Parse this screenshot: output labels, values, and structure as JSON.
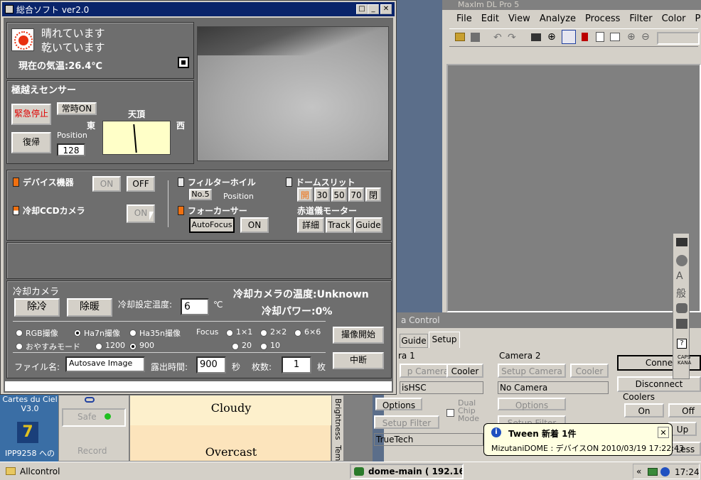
{
  "main_window": {
    "title": "総合ソフト ver2.0",
    "weather": {
      "line1": "晴れています",
      "line2": "乾いています",
      "temp": "現在の気温:26.4℃"
    },
    "meridian": {
      "title": "極越えセンサー",
      "emergency_stop": "緊急停止",
      "always_on": "常時ON",
      "reset": "復帰",
      "position_label": "Position",
      "position_value": "128",
      "east": "東",
      "zenith": "天頂",
      "west": "西"
    },
    "devices": {
      "device_label": "デバイス機器",
      "on": "ON",
      "off": "OFF",
      "ccd_label": "冷却CCDカメラ",
      "ccd_on": "ON",
      "filter_wheel": "フィルターホイル",
      "filter_no": "No.5",
      "filter_position": "Position",
      "focuser": "フォーカーサー",
      "autofocus": "AutoFocus",
      "focuser_on": "ON",
      "dome_slit": "ドームスリット",
      "slit_buttons": [
        "開",
        "30",
        "50",
        "70",
        "閉"
      ],
      "equatorial": "赤道儀モーター",
      "eq_buttons": [
        "詳細",
        "Track",
        "Guide"
      ]
    },
    "camera": {
      "title": "冷却カメラ",
      "cool": "除冷",
      "warm": "除暖",
      "set_temp_label": "冷却設定温度:",
      "set_temp_value": "6",
      "set_temp_unit": "℃",
      "temp_status": "冷却カメラの温度:Unknown",
      "power_status": "冷却パワー:0%",
      "modes": [
        "RGB撮像",
        "Ha7n撮像",
        "Ha35n撮像",
        "おやすみモード"
      ],
      "selected_mode": "Ha7n撮像",
      "focus_label": "Focus",
      "focus_options": [
        "1×1",
        "2×2",
        "6×6",
        "20",
        "10"
      ],
      "exp_options": [
        "1200",
        "900"
      ],
      "start_button": "撮像開始",
      "stop_button": "中断",
      "file_label": "ファイル名:",
      "file_value": "Autosave Image",
      "exposure_label": "露出時間:",
      "exposure_value": "900",
      "exposure_unit": "秒",
      "count_label": "枚数:",
      "count_value": "1",
      "count_unit": "枚"
    }
  },
  "maxim": {
    "title": "MaxIm DL Pro 5",
    "menu": [
      "File",
      "Edit",
      "View",
      "Analyze",
      "Process",
      "Filter",
      "Color",
      "Plug-in"
    ]
  },
  "camera_control": {
    "title": "a Control",
    "tabs": [
      "Guide",
      "Setup"
    ],
    "camera1_label": "ra 1",
    "setup_camera": "p Camera",
    "cooler": "Cooler",
    "camera1_name": "isHSC",
    "options": "Options",
    "dual_chip": "Dual Chip Mode",
    "setup_filter": "Setup Filter",
    "filter_name": "TrueTech",
    "camera2_label": "Camera 2",
    "setup_camera2": "Setup Camera",
    "cooler2": "Cooler",
    "camera2_name": "No Camera",
    "options2": "Options",
    "setup_filter2": "Setup Filter",
    "connect": "Conne",
    "disconnect": "Disconnect",
    "coolers_label": "Coolers",
    "coolers_on": "On",
    "coolers_off": "Off",
    "less": "Less"
  },
  "side_windows": {
    "cartes_title": "Cartes du Ciel V3.0",
    "ipp_label": "IPP9258 への",
    "safe": "Safe",
    "record": "Record",
    "cloudy": "Cloudy",
    "overcast": "Overcast",
    "brightness": "Brightness",
    "temp_tab": "Tem"
  },
  "notification": {
    "title": "Tween 新着 1件",
    "body": "MizutaniDOME : デバイスON 2010/03/19 17:22:43"
  },
  "taskbar": {
    "allcontrol": "Allcontrol",
    "dome_main": "dome-main ( 192.16...",
    "chevron": "«",
    "clock": "17:24"
  }
}
